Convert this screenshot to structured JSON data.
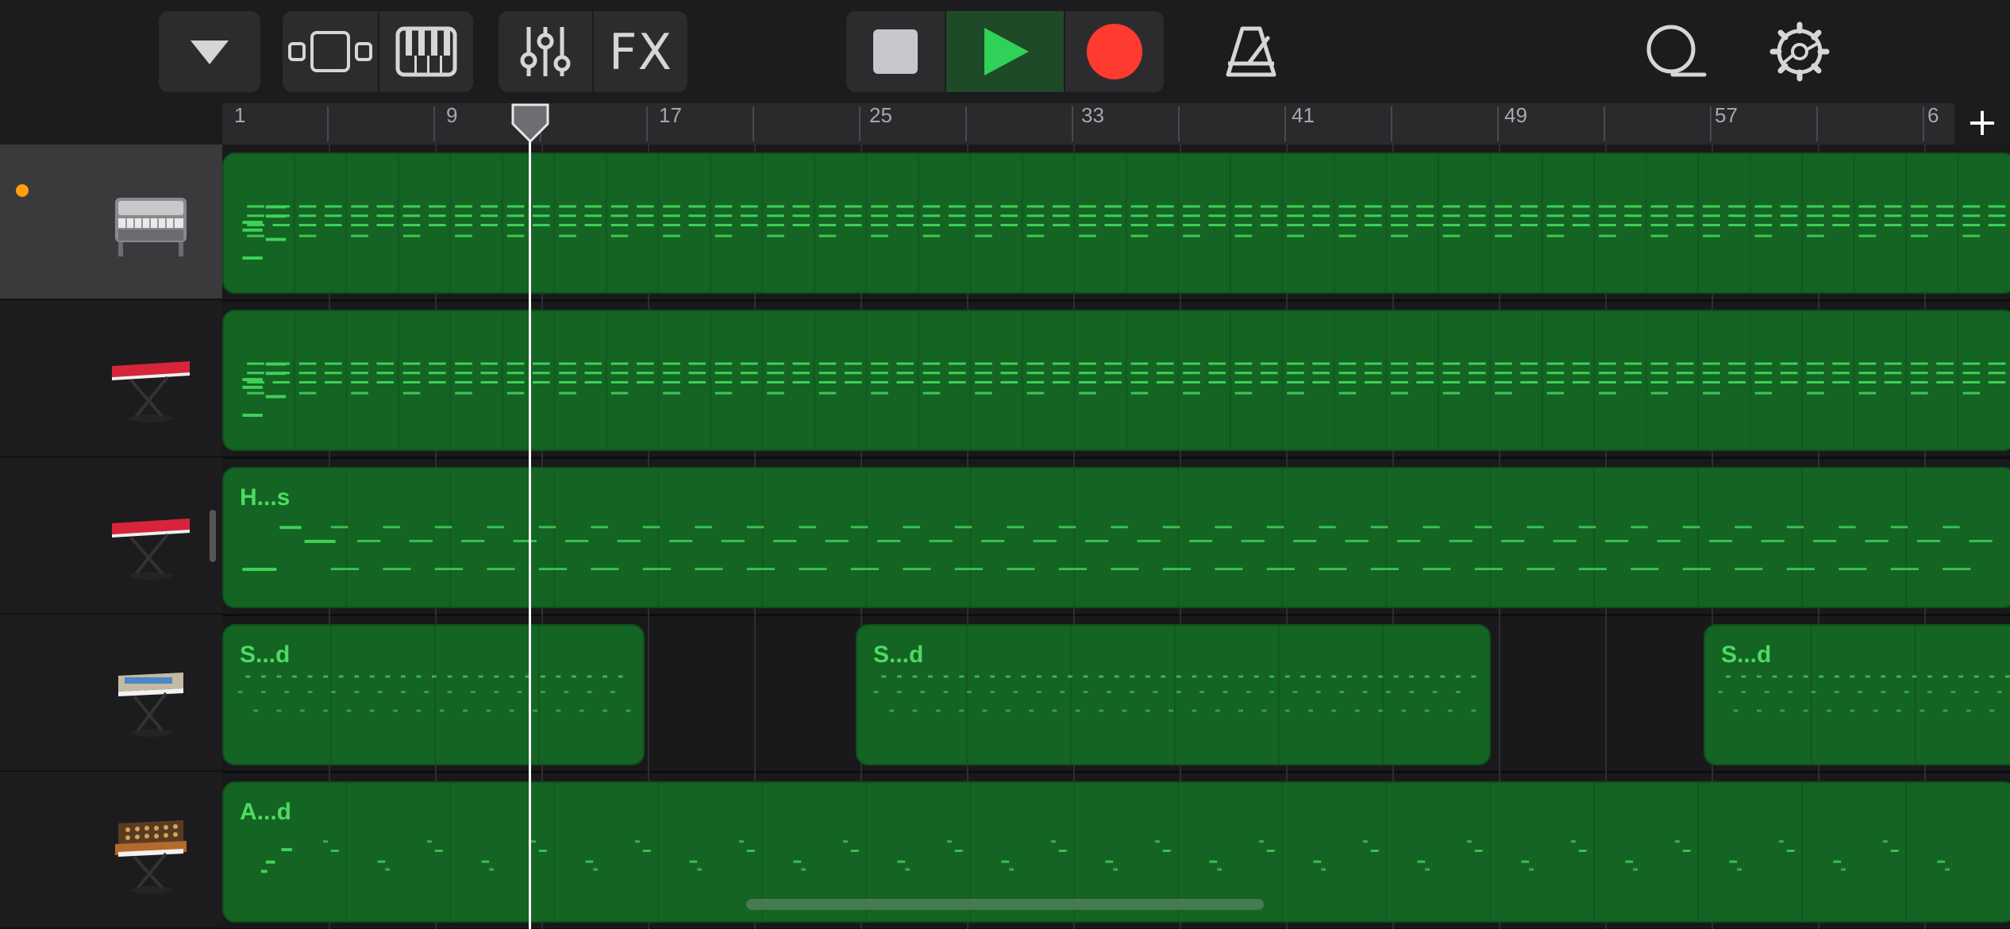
{
  "toolbar": {
    "buttons": [
      {
        "name": "browser-dropdown",
        "icon": "chevron-down-icon"
      },
      {
        "name": "tracks-view",
        "icon": "tracks-view-icon"
      },
      {
        "name": "keyboard",
        "icon": "piano-keys-icon"
      },
      {
        "name": "mixer",
        "icon": "mixer-sliders-icon"
      },
      {
        "name": "fx",
        "label": "FX"
      },
      {
        "name": "stop",
        "icon": "stop-icon"
      },
      {
        "name": "play",
        "icon": "play-icon"
      },
      {
        "name": "record",
        "icon": "record-icon"
      },
      {
        "name": "metronome",
        "icon": "metronome-icon"
      },
      {
        "name": "loop-browser",
        "icon": "loop-icon"
      },
      {
        "name": "settings",
        "icon": "gear-icon"
      }
    ],
    "fx_label": "FX"
  },
  "ruler": {
    "markers": [
      "1",
      "9",
      "17",
      "25",
      "33",
      "41",
      "49",
      "57",
      "6"
    ],
    "add_label": "+"
  },
  "colors": {
    "region_fill": "#146424",
    "note_color": "#3fd257",
    "play_green": "#30d158",
    "record_red": "#ff3b30",
    "rec_dot": "#ff9f0a",
    "background": "#1c1c1e"
  },
  "tracks": [
    {
      "instrument": "upright-electric-piano",
      "selected": true,
      "record_armed": true,
      "regions": [
        {
          "label": ""
        }
      ]
    },
    {
      "instrument": "red-stage-keyboard",
      "selected": false,
      "record_armed": false,
      "regions": [
        {
          "label": ""
        }
      ]
    },
    {
      "instrument": "red-stage-keyboard",
      "selected": false,
      "record_armed": false,
      "regions": [
        {
          "label": "H...s"
        }
      ]
    },
    {
      "instrument": "analog-synth-small",
      "selected": false,
      "record_armed": false,
      "regions": [
        {
          "label": "S...d"
        },
        {
          "label": "S...d"
        },
        {
          "label": "S...d"
        }
      ]
    },
    {
      "instrument": "analog-synth-wood",
      "selected": false,
      "record_armed": false,
      "regions": [
        {
          "label": "A...d"
        }
      ]
    }
  ]
}
